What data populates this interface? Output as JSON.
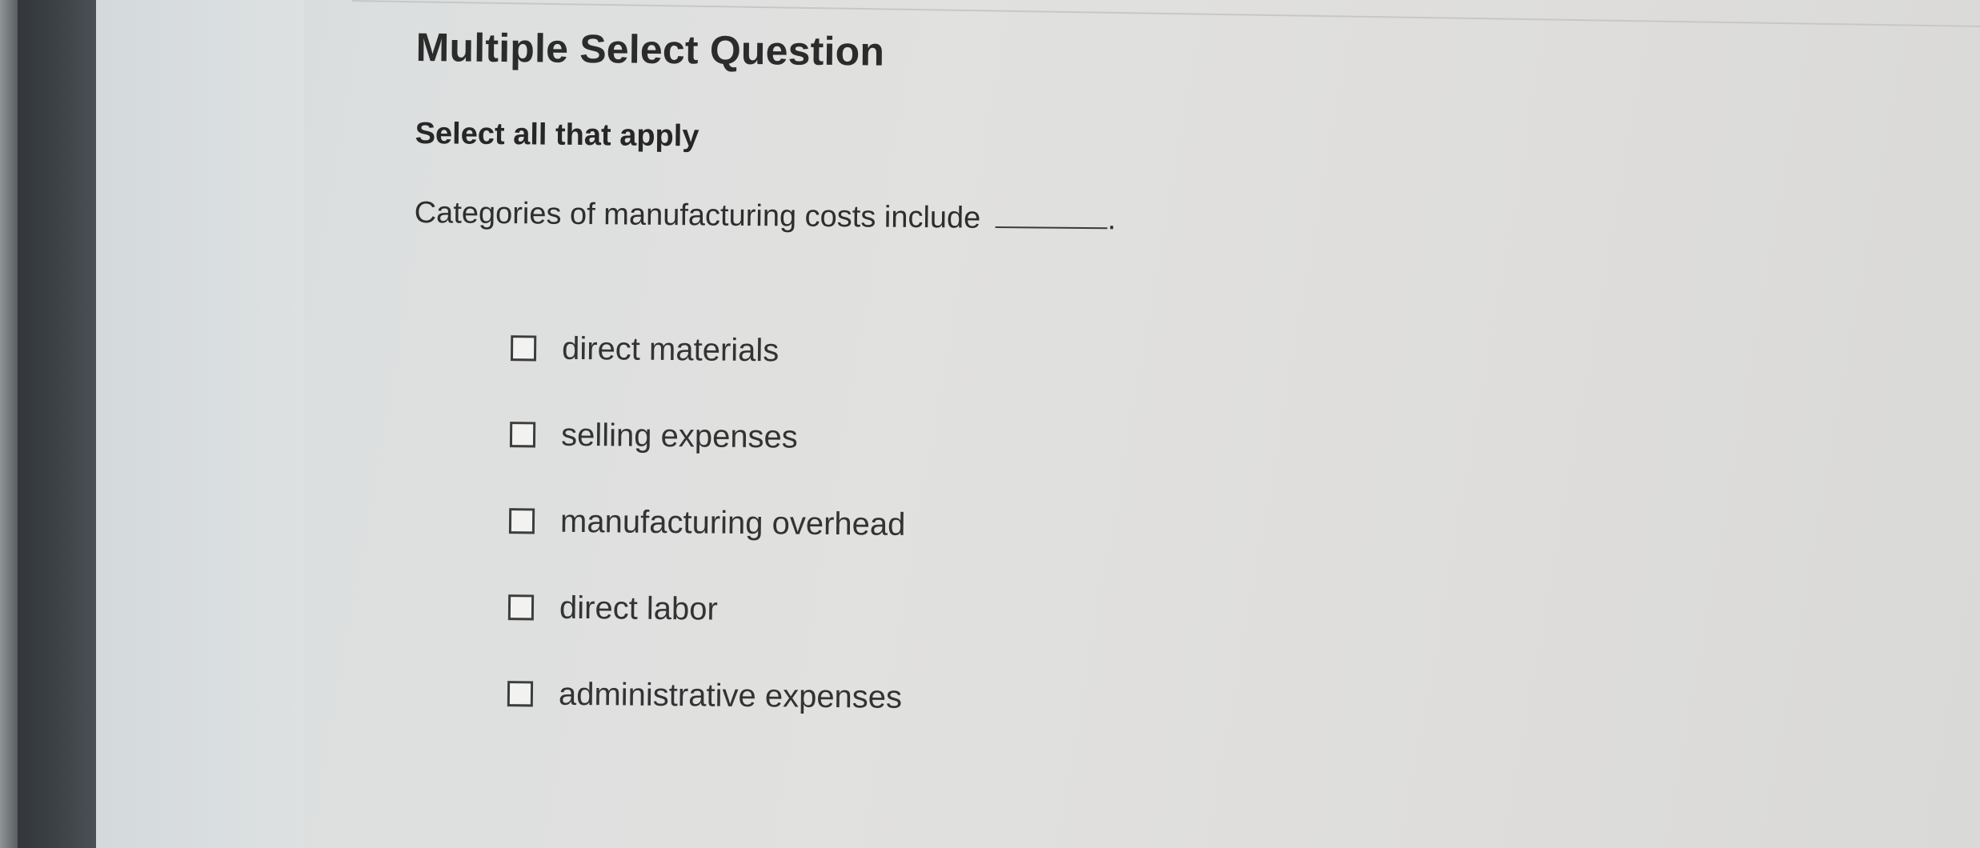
{
  "question": {
    "type_label": "Multiple Select Question",
    "instruction": "Select all that apply",
    "prompt": "Categories of manufacturing costs include",
    "prompt_suffix": "."
  },
  "options": [
    {
      "label": "direct materials",
      "checked": false
    },
    {
      "label": "selling expenses",
      "checked": false
    },
    {
      "label": "manufacturing overhead",
      "checked": false
    },
    {
      "label": "direct labor",
      "checked": false
    },
    {
      "label": "administrative expenses",
      "checked": false
    }
  ]
}
